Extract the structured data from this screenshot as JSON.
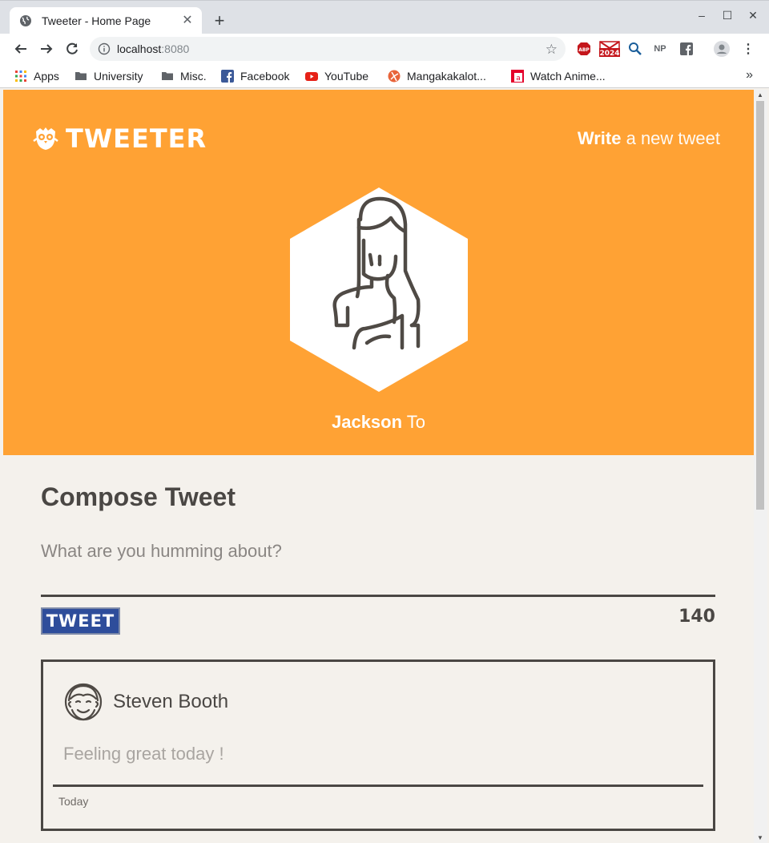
{
  "browser": {
    "tab_title": "Tweeter - Home Page",
    "url_host": "localhost",
    "url_port": ":8080",
    "bookmarks": [
      "Apps",
      "University",
      "Misc.",
      "Facebook",
      "YouTube",
      "Mangakakalot...",
      "Watch Anime..."
    ],
    "extensions": [
      "ABP",
      "2024",
      "NP"
    ]
  },
  "header": {
    "logo_text": "TWEETER",
    "compose_bold": "Write",
    "compose_rest": " a new tweet"
  },
  "profile": {
    "first_name": "Jackson",
    "last_name": " To"
  },
  "compose": {
    "title": "Compose Tweet",
    "placeholder": "What are you humming about?",
    "button_label": "TWEET",
    "counter": "140"
  },
  "tweets": [
    {
      "author": "Steven Booth",
      "content": "Feeling great today !",
      "time": "Today"
    }
  ],
  "colors": {
    "hero": "#ffa234",
    "text_dark": "#4a4744",
    "button": "#2e4d9b",
    "page_bg": "#f4f1ec"
  }
}
